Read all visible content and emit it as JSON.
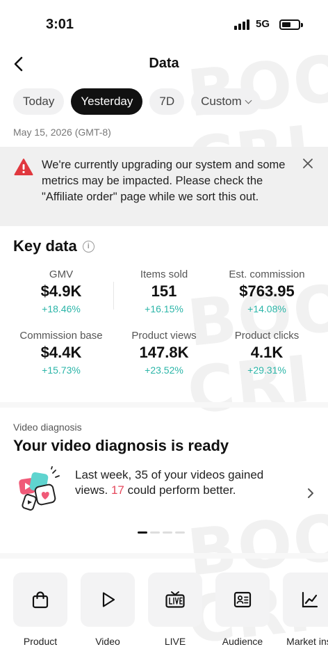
{
  "status": {
    "time": "3:01",
    "network": "5G"
  },
  "header": {
    "title": "Data"
  },
  "tabs": [
    {
      "label": "Today"
    },
    {
      "label": "Yesterday",
      "active": true
    },
    {
      "label": "7D"
    },
    {
      "label": "Custom"
    }
  ],
  "date_range": "May 15, 2026 (GMT-8)",
  "banner": {
    "text": "We're currently upgrading our system and some metrics may be impacted. Please check the \"Affiliate order\" page while we sort this out."
  },
  "key_data": {
    "title": "Key data",
    "metrics": [
      {
        "label": "GMV",
        "value": "$4.9K",
        "change": "+18.46%"
      },
      {
        "label": "Items sold",
        "value": "151",
        "change": "+16.15%"
      },
      {
        "label": "Est. commission",
        "value": "$763.95",
        "change": "+14.08%"
      },
      {
        "label": "Commission base",
        "value": "$4.4K",
        "change": "+15.73%"
      },
      {
        "label": "Product views",
        "value": "147.8K",
        "change": "+23.52%"
      },
      {
        "label": "Product clicks",
        "value": "4.1K",
        "change": "+29.31%"
      }
    ]
  },
  "video_diagnosis": {
    "label": "Video diagnosis",
    "title": "Your video diagnosis is ready",
    "text_prefix": "Last week, 35 of your videos gained views. ",
    "highlight": "17",
    "text_suffix": " could perform better.",
    "highlight_color": "#e5485c",
    "carousel_pages": 4,
    "carousel_active": 1
  },
  "toolbar": [
    {
      "label": "Product",
      "icon": "shopping-bag-icon"
    },
    {
      "label": "Video",
      "icon": "play-icon"
    },
    {
      "label": "LIVE",
      "icon": "live-tv-icon"
    },
    {
      "label": "Audience",
      "icon": "id-card-icon"
    },
    {
      "label": "Market insi",
      "icon": "line-chart-icon"
    }
  ],
  "colors": {
    "accent_positive": "#2bb5a8",
    "warning": "#e0383e",
    "active_tab": "#111111"
  },
  "watermark": {
    "lines": [
      "BOO",
      "CRI",
      "BOO",
      "CRI",
      "BOO",
      "CRI"
    ]
  }
}
